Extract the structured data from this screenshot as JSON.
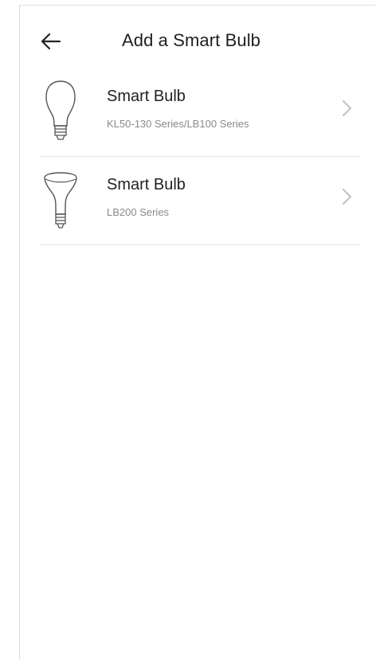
{
  "header": {
    "title": "Add a Smart Bulb",
    "back_icon": "arrow-left-icon"
  },
  "bulbs": [
    {
      "title": "Smart Bulb",
      "subtitle": "KL50-130 Series/LB100 Series",
      "icon": "a19-bulb-icon"
    },
    {
      "title": "Smart Bulb",
      "subtitle": "LB200 Series",
      "icon": "br30-flood-bulb-icon"
    }
  ],
  "colors": {
    "text_primary": "#222222",
    "text_secondary": "#8a8a8a",
    "divider": "#e4e4e4",
    "icon_stroke": "#555555",
    "chevron": "#c4c4c4"
  }
}
